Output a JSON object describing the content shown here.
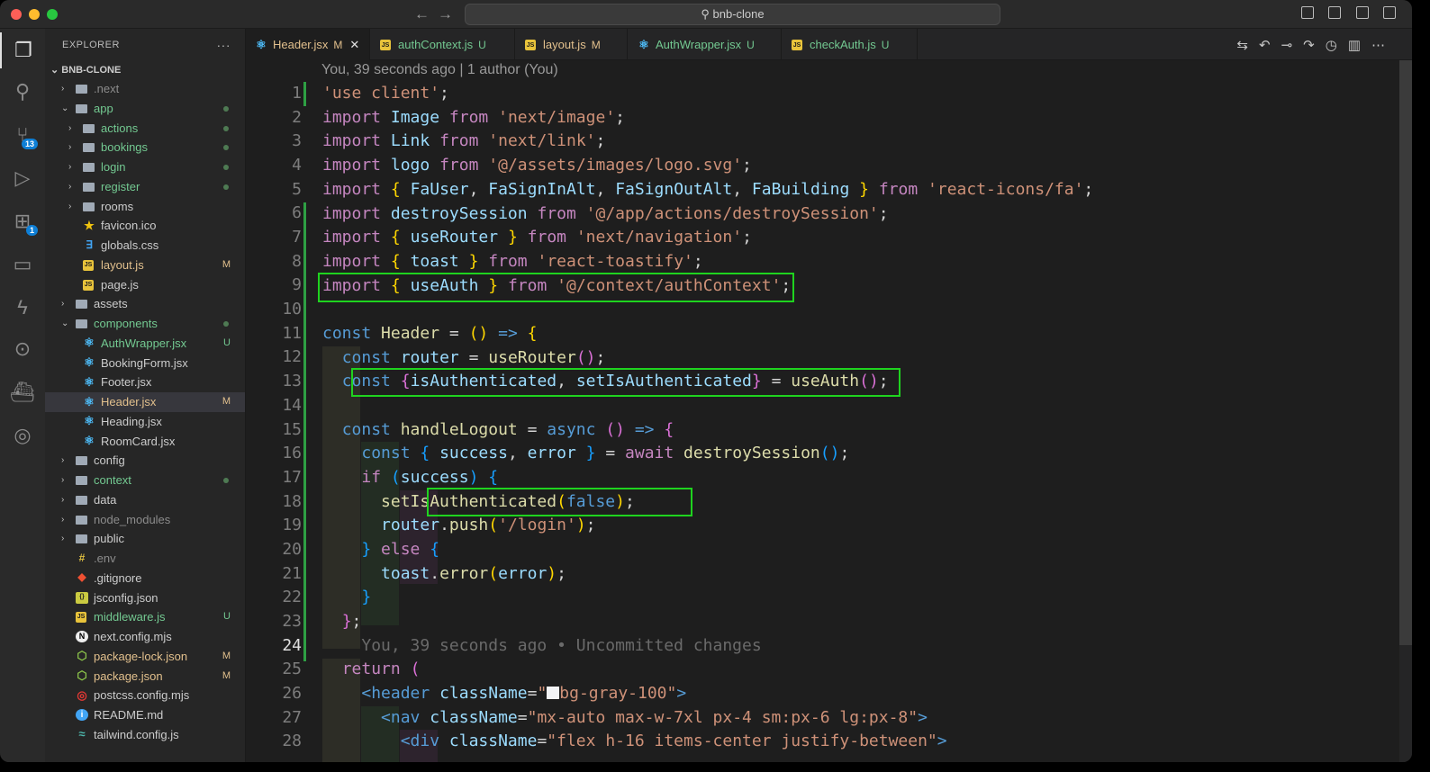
{
  "window": {
    "title": "bnb-clone"
  },
  "sidebar": {
    "title": "EXPLORER",
    "root": "BNB-CLONE",
    "items": [
      {
        "label": ".next",
        "depth": 0,
        "chev": "›",
        "icon": "folder-icon",
        "status": "",
        "dot": false,
        "color": "gray"
      },
      {
        "label": "app",
        "depth": 0,
        "chev": "⌄",
        "icon": "folder-icon",
        "status": "",
        "dot": true,
        "color": "green"
      },
      {
        "label": "actions",
        "depth": 1,
        "chev": "›",
        "icon": "folder-icon",
        "status": "",
        "dot": true,
        "color": "green"
      },
      {
        "label": "bookings",
        "depth": 1,
        "chev": "›",
        "icon": "folder-icon",
        "status": "",
        "dot": true,
        "color": "green"
      },
      {
        "label": "login",
        "depth": 1,
        "chev": "›",
        "icon": "folder-icon",
        "status": "",
        "dot": true,
        "color": "green"
      },
      {
        "label": "register",
        "depth": 1,
        "chev": "›",
        "icon": "folder-icon",
        "status": "",
        "dot": true,
        "color": "green"
      },
      {
        "label": "rooms",
        "depth": 1,
        "chev": "›",
        "icon": "folder-icon",
        "status": "",
        "dot": false,
        "color": "normal"
      },
      {
        "label": "favicon.ico",
        "depth": 1,
        "chev": "",
        "icon": "star-icon",
        "status": "",
        "dot": false,
        "color": "normal"
      },
      {
        "label": "globals.css",
        "depth": 1,
        "chev": "",
        "icon": "css-icon",
        "status": "",
        "dot": false,
        "color": "normal"
      },
      {
        "label": "layout.js",
        "depth": 1,
        "chev": "",
        "icon": "js-icon",
        "status": "M",
        "dot": false,
        "color": "yellow"
      },
      {
        "label": "page.js",
        "depth": 1,
        "chev": "",
        "icon": "js-icon",
        "status": "",
        "dot": false,
        "color": "normal"
      },
      {
        "label": "assets",
        "depth": 0,
        "chev": "›",
        "icon": "folder-icon",
        "status": "",
        "dot": false,
        "color": "normal"
      },
      {
        "label": "components",
        "depth": 0,
        "chev": "⌄",
        "icon": "folder-icon",
        "status": "",
        "dot": true,
        "color": "green"
      },
      {
        "label": "AuthWrapper.jsx",
        "depth": 1,
        "chev": "",
        "icon": "react-icon",
        "status": "U",
        "dot": false,
        "color": "green"
      },
      {
        "label": "BookingForm.jsx",
        "depth": 1,
        "chev": "",
        "icon": "react-icon",
        "status": "",
        "dot": false,
        "color": "normal"
      },
      {
        "label": "Footer.jsx",
        "depth": 1,
        "chev": "",
        "icon": "react-icon",
        "status": "",
        "dot": false,
        "color": "normal"
      },
      {
        "label": "Header.jsx",
        "depth": 1,
        "chev": "",
        "icon": "react-icon",
        "status": "M",
        "dot": false,
        "color": "yellow",
        "selected": true
      },
      {
        "label": "Heading.jsx",
        "depth": 1,
        "chev": "",
        "icon": "react-icon",
        "status": "",
        "dot": false,
        "color": "normal"
      },
      {
        "label": "RoomCard.jsx",
        "depth": 1,
        "chev": "",
        "icon": "react-icon",
        "status": "",
        "dot": false,
        "color": "normal"
      },
      {
        "label": "config",
        "depth": 0,
        "chev": "›",
        "icon": "folder-icon",
        "status": "",
        "dot": false,
        "color": "normal"
      },
      {
        "label": "context",
        "depth": 0,
        "chev": "›",
        "icon": "folder-icon",
        "status": "",
        "dot": true,
        "color": "green"
      },
      {
        "label": "data",
        "depth": 0,
        "chev": "›",
        "icon": "folder-icon",
        "status": "",
        "dot": false,
        "color": "normal"
      },
      {
        "label": "node_modules",
        "depth": 0,
        "chev": "›",
        "icon": "folder-icon",
        "status": "",
        "dot": false,
        "color": "gray"
      },
      {
        "label": "public",
        "depth": 0,
        "chev": "›",
        "icon": "folder-icon",
        "status": "",
        "dot": false,
        "color": "normal"
      },
      {
        "label": ".env",
        "depth": 0,
        "chev": "",
        "icon": "env-icon",
        "status": "",
        "dot": false,
        "color": "gray"
      },
      {
        "label": ".gitignore",
        "depth": 0,
        "chev": "",
        "icon": "git-icon",
        "status": "",
        "dot": false,
        "color": "normal"
      },
      {
        "label": "jsconfig.json",
        "depth": 0,
        "chev": "",
        "icon": "json-icon",
        "status": "",
        "dot": false,
        "color": "normal"
      },
      {
        "label": "middleware.js",
        "depth": 0,
        "chev": "",
        "icon": "js-icon",
        "status": "U",
        "dot": false,
        "color": "green"
      },
      {
        "label": "next.config.mjs",
        "depth": 0,
        "chev": "",
        "icon": "next-icon",
        "status": "",
        "dot": false,
        "color": "normal"
      },
      {
        "label": "package-lock.json",
        "depth": 0,
        "chev": "",
        "icon": "node-icon",
        "status": "M",
        "dot": false,
        "color": "yellow"
      },
      {
        "label": "package.json",
        "depth": 0,
        "chev": "",
        "icon": "node-icon",
        "status": "M",
        "dot": false,
        "color": "yellow"
      },
      {
        "label": "postcss.config.mjs",
        "depth": 0,
        "chev": "",
        "icon": "postcss-icon",
        "status": "",
        "dot": false,
        "color": "normal"
      },
      {
        "label": "README.md",
        "depth": 0,
        "chev": "",
        "icon": "info-icon",
        "status": "",
        "dot": false,
        "color": "normal"
      },
      {
        "label": "tailwind.config.js",
        "depth": 0,
        "chev": "",
        "icon": "tailwind-icon",
        "status": "",
        "dot": false,
        "color": "normal"
      }
    ]
  },
  "activity_badges": {
    "scm": "13",
    "extensions": "1"
  },
  "tabs": [
    {
      "label": "Header.jsx",
      "status": "M",
      "icon": "react-icon",
      "active": true
    },
    {
      "label": "authContext.js",
      "status": "U",
      "icon": "js-icon",
      "active": false
    },
    {
      "label": "layout.js",
      "status": "M",
      "icon": "js-icon",
      "active": false
    },
    {
      "label": "AuthWrapper.jsx",
      "status": "U",
      "icon": "react-icon",
      "active": false
    },
    {
      "label": "checkAuth.js",
      "status": "U",
      "icon": "js-icon",
      "active": false
    }
  ],
  "editor": {
    "blame_header": "You, 39 seconds ago | 1 author (You)",
    "inline_blame": "You, 39 seconds ago • Uncommitted changes",
    "line_numbers": [
      "1",
      "2",
      "3",
      "4",
      "5",
      "6",
      "7",
      "8",
      "9",
      "10",
      "11",
      "12",
      "13",
      "14",
      "15",
      "16",
      "17",
      "18",
      "19",
      "20",
      "21",
      "22",
      "23",
      "24",
      "25",
      "26",
      "27",
      "28"
    ],
    "current_line": "24"
  },
  "colors": {
    "highlight": "#1fd31f",
    "accent": "#0e7fd6",
    "modified": "#2ea043"
  }
}
